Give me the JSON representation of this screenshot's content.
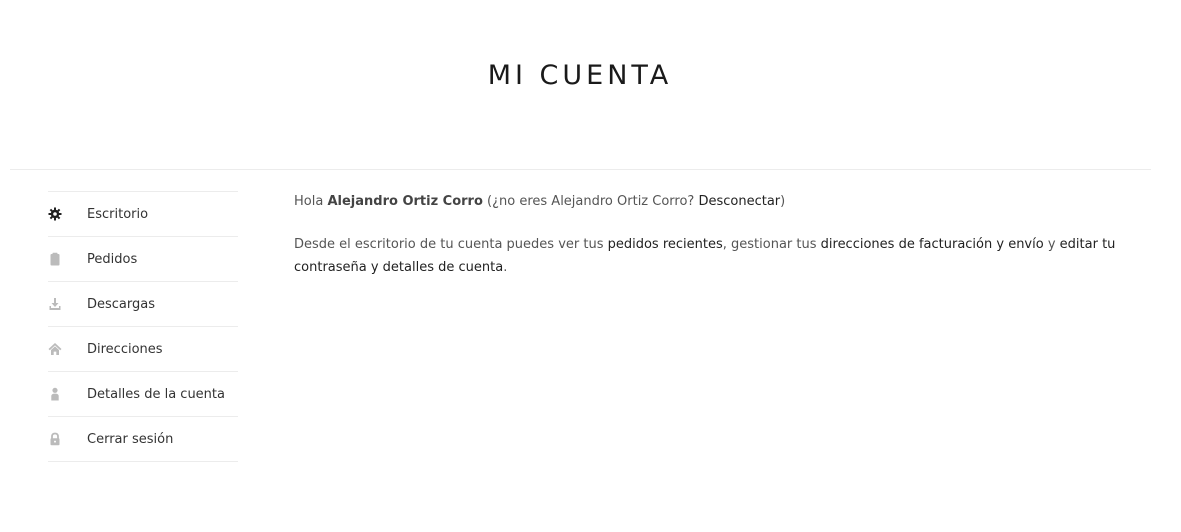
{
  "page": {
    "title": "MI CUENTA"
  },
  "sidebar": {
    "items": [
      {
        "label": "Escritorio",
        "icon": "gear-icon",
        "active": true
      },
      {
        "label": "Pedidos",
        "icon": "clipboard-icon"
      },
      {
        "label": "Descargas",
        "icon": "download-icon"
      },
      {
        "label": "Direcciones",
        "icon": "home-icon"
      },
      {
        "label": "Detalles de la cuenta",
        "icon": "user-icon"
      },
      {
        "label": "Cerrar sesión",
        "icon": "lock-icon"
      }
    ]
  },
  "greeting": {
    "hello": "Hola ",
    "user_name": "Alejandro Ortiz Corro",
    "not_you_prefix": " (¿no eres Alejandro Ortiz Corro? ",
    "logout_link": "Desconectar",
    "not_you_suffix": ")"
  },
  "dashboard_text": {
    "part1": "Desde el escritorio de tu cuenta puedes ver tus ",
    "recent_orders_link": "pedidos recientes",
    "part2": ", gestionar tus ",
    "addresses_link": "direcciones de facturación y envío",
    "part3": " y ",
    "edit_link": "editar tu contraseña y detalles de cuenta",
    "part4": "."
  },
  "colors": {
    "active_icon": "#222222",
    "inactive_icon": "#bbbbbb",
    "divider": "#ececec"
  }
}
